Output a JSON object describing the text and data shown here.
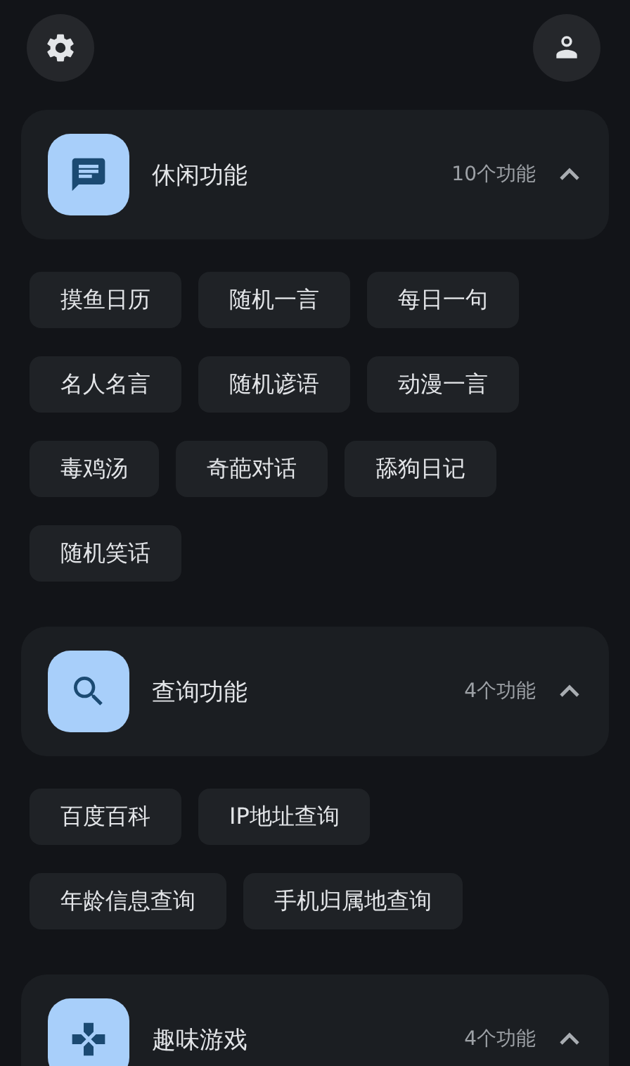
{
  "sections": [
    {
      "kind": "chat",
      "title": "休闲功能",
      "count": "10个功能",
      "expanded": true,
      "items": [
        "摸鱼日历",
        "随机一言",
        "每日一句",
        "名人名言",
        "随机谚语",
        "动漫一言",
        "毒鸡汤",
        "奇葩对话",
        "舔狗日记",
        "随机笑话"
      ]
    },
    {
      "kind": "search",
      "title": "查询功能",
      "count": "4个功能",
      "expanded": true,
      "items": [
        "百度百科",
        "IP地址查询",
        "年龄信息查询",
        "手机归属地查询"
      ]
    },
    {
      "kind": "game",
      "title": "趣味游戏",
      "count": "4个功能",
      "expanded": true
    }
  ]
}
